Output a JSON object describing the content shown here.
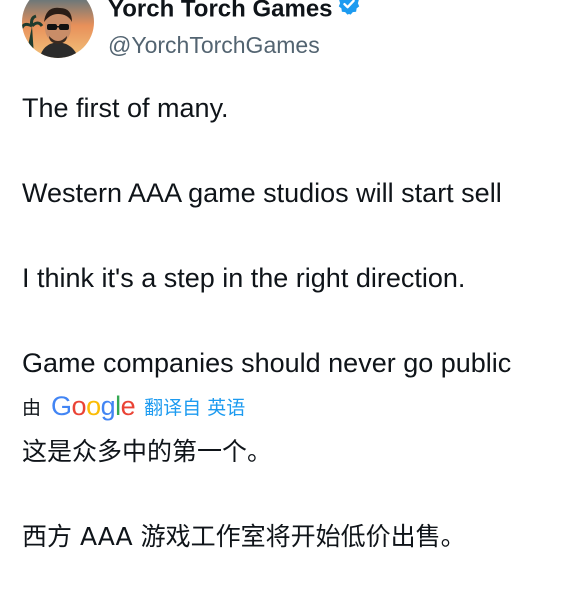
{
  "author": {
    "display_name": "Yorch Torch Games",
    "handle": "@YorchTorchGames",
    "verified": true
  },
  "tweet": {
    "lines": [
      "The first of many.",
      "Western AAA game studios will start sell",
      "I think it's a step in the right direction.",
      "Game companies should never go public"
    ]
  },
  "translation": {
    "prefix": "由",
    "provider": "Google",
    "link_label": "翻译自 英语",
    "lines": [
      "这是众多中的第一个。",
      "西方 AAA 游戏工作室将开始低价出售。"
    ]
  },
  "colors": {
    "text": "#0f1419",
    "secondary_text": "#536471",
    "link": "#1d9bf0",
    "verified_badge": "#1d9bf0",
    "google_blue": "#4285F4",
    "google_red": "#EA4335",
    "google_yellow": "#FBBC05",
    "google_green": "#34A853"
  }
}
